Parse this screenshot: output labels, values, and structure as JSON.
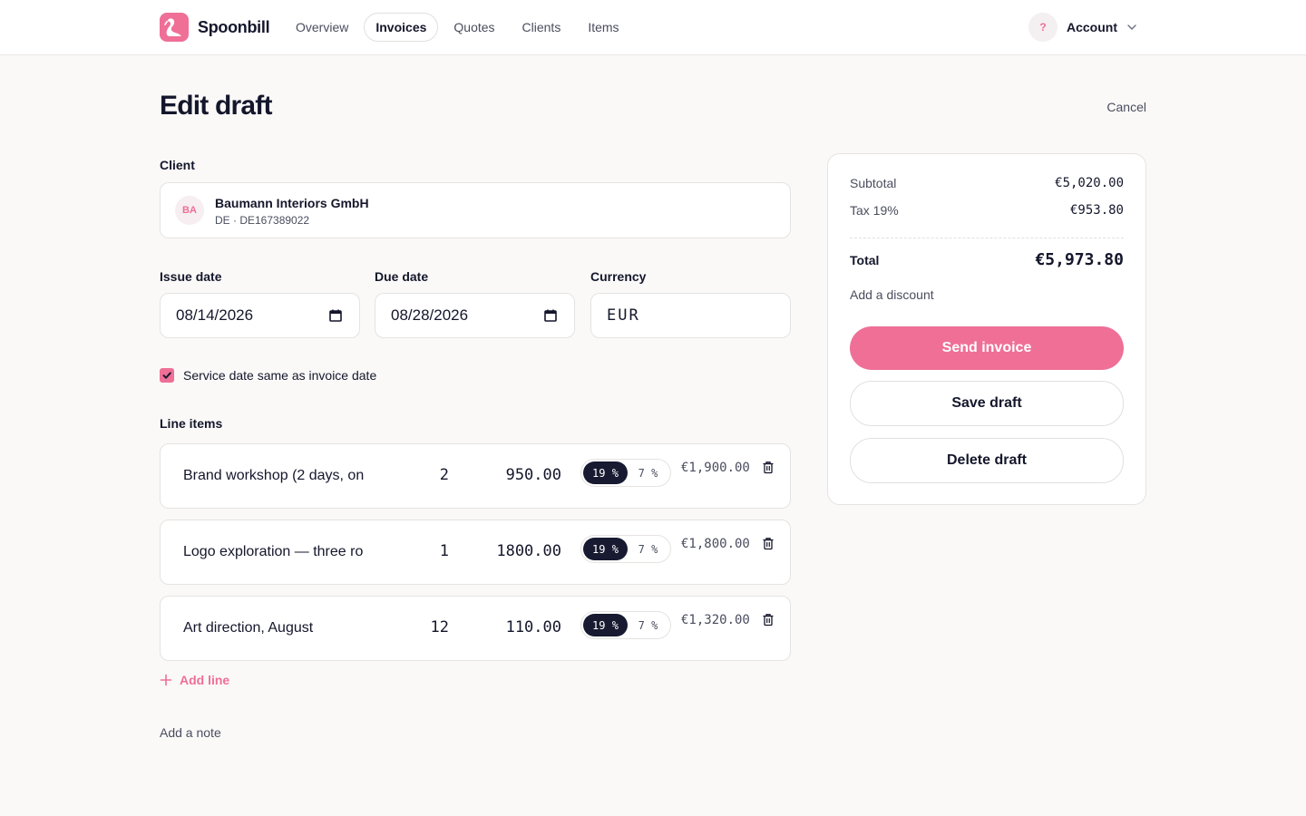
{
  "header": {
    "brand": "Spoonbill",
    "nav": [
      "Overview",
      "Invoices",
      "Quotes",
      "Clients",
      "Items"
    ],
    "active_nav": "Invoices",
    "help_badge": "?",
    "account_label": "Account"
  },
  "page": {
    "title": "Edit draft",
    "cancel_label": "Cancel"
  },
  "client": {
    "label": "Client",
    "initials": "BA",
    "name": "Baumann Interiors GmbH",
    "sub": "DE · DE167389022"
  },
  "fields": {
    "issue_label": "Issue date",
    "issue_value": "08/14/2026",
    "due_label": "Due date",
    "due_value": "08/28/2026",
    "currency_label": "Currency",
    "currency_value": "EUR"
  },
  "service_checkbox": {
    "label": "Service date same as invoice date",
    "checked": true
  },
  "line_items": {
    "label": "Line items",
    "rows": [
      {
        "desc": "Brand workshop (2 days, on",
        "qty": "2",
        "price": "950.00",
        "tax_on": "19 %",
        "tax_off": "7 %",
        "amount": "€1,900.00"
      },
      {
        "desc": "Logo exploration — three ro",
        "qty": "1",
        "price": "1800.00",
        "tax_on": "19 %",
        "tax_off": "7 %",
        "amount": "€1,800.00"
      },
      {
        "desc": "Art direction, August",
        "qty": "12",
        "price": "110.00",
        "tax_on": "19 %",
        "tax_off": "7 %",
        "amount": "€1,320.00"
      }
    ],
    "add_line": "Add line",
    "add_note": "Add a note"
  },
  "summary": {
    "subtotal_label": "Subtotal",
    "subtotal_value": "€5,020.00",
    "tax_label": "Tax 19%",
    "tax_value": "€953.80",
    "total_label": "Total",
    "total_value": "€5,973.80",
    "discount_link": "Add a discount",
    "send": "Send invoice",
    "save": "Save draft",
    "delete": "Delete draft"
  },
  "colors": {
    "accent": "#ef6f97",
    "dark": "#171a30",
    "background": "#faf9f8"
  }
}
